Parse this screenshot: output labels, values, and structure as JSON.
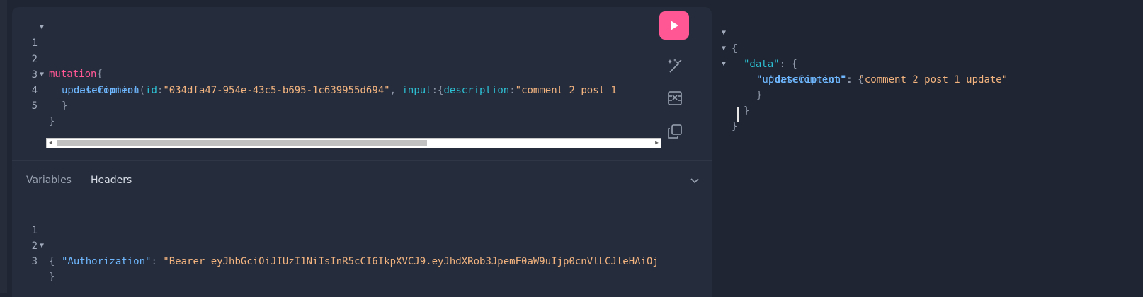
{
  "query": {
    "lines": [
      {
        "num": "1",
        "t1": "mutation",
        "t2": "{"
      },
      {
        "num": "2",
        "t1": "updateComment",
        "t2": "(",
        "t3": "id",
        "t4": ":",
        "t5": "\"034dfa47-954e-43c5-b695-1c639955d694\"",
        "t6": ", ",
        "t7": "input",
        "t8": ":{",
        "t9": "description",
        "t10": ":",
        "t11": "\"comment 2 post 1"
      },
      {
        "num": "3",
        "t1": "description"
      },
      {
        "num": "4",
        "t1": "}"
      },
      {
        "num": "5",
        "t1": "}"
      }
    ]
  },
  "tabs": {
    "variables": "Variables",
    "headers": "Headers"
  },
  "headers_editor": {
    "lines": [
      {
        "num": "1",
        "t1": "{"
      },
      {
        "num": "2",
        "t1": "\"Authorization\"",
        "t2": ": ",
        "t3": "\"Bearer eyJhbGciOiJIUzI1NiIsInR5cCI6IkpXVCJ9.eyJhdXRob3JpemF0aW9uIjp0cnVlLCJleHAiOj"
      },
      {
        "num": "3",
        "t1": "}"
      }
    ]
  },
  "result": {
    "l1": "{",
    "l2k": "\"data\"",
    "l2s": ": {",
    "l3k": "\"updateComment\"",
    "l3s": ": {",
    "l4k": "\"description\"",
    "l4c": ": ",
    "l4v": "\"comment 2 post 1 update\"",
    "l5": "}",
    "l6": "}",
    "l7": "}"
  },
  "colors": {
    "accent": "#ff5794",
    "background": "#1f2532",
    "panel": "#252d3d"
  },
  "icons": [
    "play-icon",
    "prettify-icon",
    "merge-fragments-icon",
    "copy-icon",
    "chevron-down-icon",
    "fold-arrow-icon"
  ]
}
